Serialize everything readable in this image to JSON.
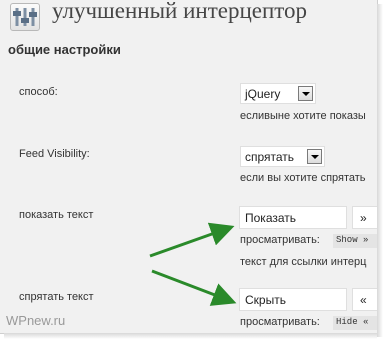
{
  "header": {
    "title": "улучшенный интерцептор",
    "icon": "settings-sliders-icon"
  },
  "section": {
    "title": "общие настройки"
  },
  "settings": {
    "method": {
      "label": "способ:",
      "selected": "jQuery",
      "description": "есливыне хотите показы"
    },
    "feed_visibility": {
      "label": "Feed Visibility:",
      "selected": "спрятать",
      "description": "если вы хотите спрятать"
    },
    "show_text": {
      "label": "показать текст",
      "value": "Показать",
      "symbol": "»",
      "preview_label": "просматривать:",
      "preview_code": "Show »",
      "description": "текст для ссылки интерц"
    },
    "hide_text": {
      "label": "спрятать текст",
      "value": "Скрыть",
      "symbol": "«",
      "preview_label": "просматривать:",
      "preview_code": "Hide «"
    }
  },
  "annotations": {
    "arrow_color": "#2a8a2a"
  },
  "watermark": {
    "text": "WPnew.ru"
  },
  "colors": {
    "panel_background": "#f1f1f1",
    "title_text": "#464646",
    "input_border": "#dfdfdf"
  }
}
